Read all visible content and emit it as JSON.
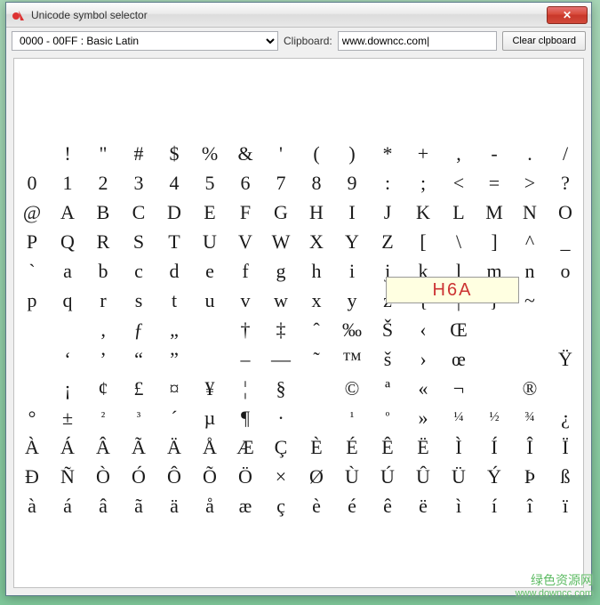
{
  "window": {
    "title": "Unicode symbol selector"
  },
  "toolbar": {
    "range_selected": "0000 - 00FF :  Basic Latin",
    "clipboard_label": "Clipboard:",
    "clipboard_value": "www.downcc.com|",
    "clear_label": "Clear clpboard"
  },
  "tooltip": {
    "text": "H6A"
  },
  "watermark": {
    "line1": "绿色资源网",
    "line2": "www.downcc.com"
  },
  "grid": {
    "rows": [
      [
        "",
        "!",
        "\"",
        "#",
        "$",
        "%",
        "&",
        "'",
        "(",
        ")",
        "*",
        "+",
        ",",
        "-",
        ".",
        "/"
      ],
      [
        "0",
        "1",
        "2",
        "3",
        "4",
        "5",
        "6",
        "7",
        "8",
        "9",
        ":",
        ";",
        "<",
        "=",
        ">",
        "?"
      ],
      [
        "@",
        "A",
        "B",
        "C",
        "D",
        "E",
        "F",
        "G",
        "H",
        "I",
        "J",
        "K",
        "L",
        "M",
        "N",
        "O"
      ],
      [
        "P",
        "Q",
        "R",
        "S",
        "T",
        "U",
        "V",
        "W",
        "X",
        "Y",
        "Z",
        "[",
        "\\",
        "]",
        "^",
        "_"
      ],
      [
        "`",
        "a",
        "b",
        "c",
        "d",
        "e",
        "f",
        "g",
        "h",
        "i",
        "j",
        "k",
        "l",
        "m",
        "n",
        "o"
      ],
      [
        "p",
        "q",
        "r",
        "s",
        "t",
        "u",
        "v",
        "w",
        "x",
        "y",
        "z",
        "{",
        "|",
        "}",
        "~",
        ""
      ],
      [
        "",
        "",
        "‚",
        "ƒ",
        "„",
        "",
        "†",
        "‡",
        "ˆ",
        "‰",
        "Š",
        "‹",
        "Œ",
        "",
        "",
        ""
      ],
      [
        "",
        "‘",
        "’",
        "“",
        "”",
        "",
        "–",
        "—",
        "˜",
        "™",
        "š",
        "›",
        "œ",
        "",
        "",
        "Ÿ"
      ],
      [
        "",
        "¡",
        "¢",
        "£",
        "¤",
        "¥",
        "¦",
        "§",
        "",
        "©",
        "ª",
        "«",
        "¬",
        "",
        "®",
        ""
      ],
      [
        "°",
        "±",
        "²",
        "³",
        "´",
        "µ",
        "¶",
        "·",
        "",
        "¹",
        "º",
        "»",
        "¼",
        "½",
        "¾",
        "¿"
      ],
      [
        "À",
        "Á",
        "Â",
        "Ã",
        "Ä",
        "Å",
        "Æ",
        "Ç",
        "È",
        "É",
        "Ê",
        "Ë",
        "Ì",
        "Í",
        "Î",
        "Ï"
      ],
      [
        "Ð",
        "Ñ",
        "Ò",
        "Ó",
        "Ô",
        "Õ",
        "Ö",
        "×",
        "Ø",
        "Ù",
        "Ú",
        "Û",
        "Ü",
        "Ý",
        "Þ",
        "ß"
      ],
      [
        "à",
        "á",
        "â",
        "ã",
        "ä",
        "å",
        "æ",
        "ç",
        "è",
        "é",
        "ê",
        "ë",
        "ì",
        "í",
        "î",
        "ï"
      ]
    ]
  }
}
